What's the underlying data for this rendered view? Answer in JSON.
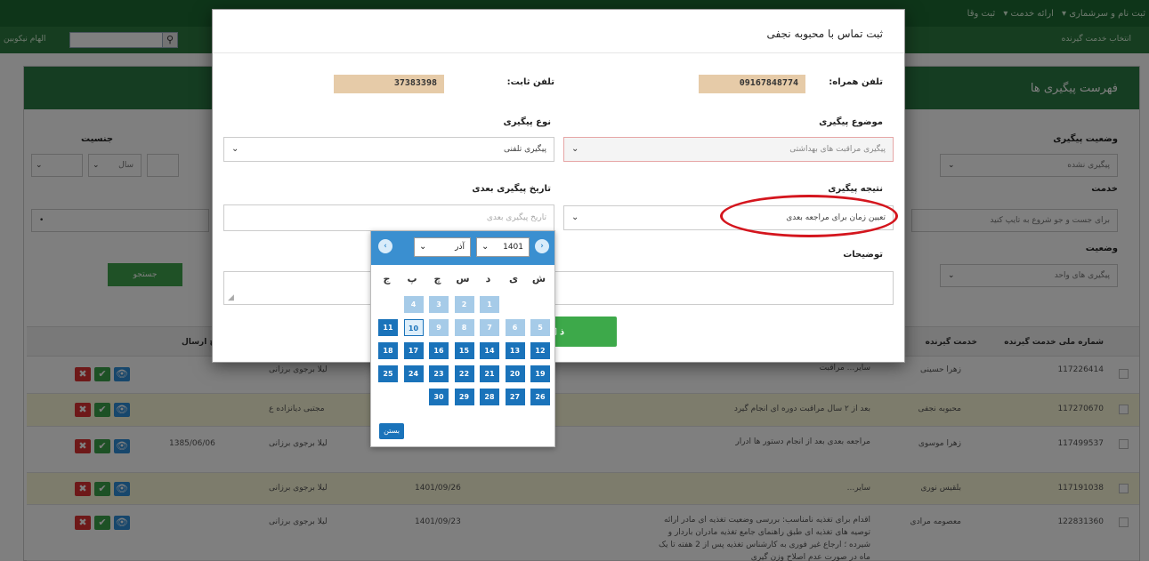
{
  "topbar": {
    "items": [
      "ثبت نام و سرشماری ▾",
      "ارائه خدمت ▾",
      "ثبت وقا"
    ]
  },
  "subbar": {
    "crumb": "انتخاب خدمت گیرنده",
    "user": "الهام نیکوبین",
    "search_placeholder": "جستجو ملی..."
  },
  "panel": {
    "title": "فهرست پیگیری ها",
    "filters": {
      "status_label": "وضعیت پیگیری",
      "status_value": "پیگیری نشده",
      "service_label": "خدمت",
      "service_placeholder": "برای جست و جو شروع به تایپ کنید",
      "state_label": "وضعیت",
      "state_value": "پیگیری های واحد",
      "gender_label": "جنسیت",
      "age_unit": "سال",
      "search_button": "جستجو"
    },
    "table": {
      "headers": [
        "شماره ملی خدمت گیرنده",
        "خدمت گیرنده",
        "تاریخ ارسال"
      ],
      "rows": [
        {
          "id": "117226414",
          "name": "زهرا حسینی",
          "desc": "سایر... مراقبت",
          "staff": "لیلا برجوی برزانی",
          "date": "",
          "send": ""
        },
        {
          "id": "117270670",
          "name": "محبوبه نجفی",
          "desc": "بعد از ۲ سال مراقبت دوره ای انجام گیرد",
          "staff": "مجتبی دیانزاده ع",
          "date": "",
          "send": ""
        },
        {
          "id": "117499537",
          "name": "زهرا موسوی",
          "desc": "مراجعه بعدی بعد از انجام دستور ها ادرار",
          "staff": "لیلا برجوی برزانی",
          "date": "",
          "send": "1385/06/06"
        },
        {
          "id": "117191038",
          "name": "بلقیس نوری",
          "desc": "سایر...",
          "staff": "لیلا برجوی برزانی",
          "date": "1401/09/26",
          "send": ""
        },
        {
          "id": "122831360",
          "name": "معصومه مرادی",
          "desc": "اقدام برای تغذیه نامناسب: بررسی وضعیت تغذیه ای مادر ارائه توصیه های تغذیه ای طبق راهنمای جامع تغذیه مادران باردار و شیرده ؛ ارجاع غیر فوری به کارشناس تغذیه پس از 2 هفته تا یک ماه در صورت عدم اصلاح وزن گیری",
          "staff": "لیلا برجوی برزانی",
          "date": "1401/09/23",
          "send": ""
        }
      ],
      "actions": {
        "delete": "✖",
        "confirm": "✔",
        "view": "👁"
      }
    }
  },
  "modal": {
    "title": "ثبت تماس با محبوبه نجفی",
    "mobile_label": "تلفن همراه:",
    "mobile_value": "09167848774",
    "landline_label": "تلفن ثابت:",
    "landline_value": "37383398",
    "subject_label": "موضوع پیگیری",
    "subject_value": "پیگیری مراقبت های بهداشتی",
    "type_label": "نوع پیگیری",
    "type_value": "پیگیری تلفنی",
    "result_label": "نتیجه پیگیری",
    "result_value": "تعیین زمان برای مراجعه بعدی",
    "next_date_label": "تاریخ پیگیری بعدی",
    "next_date_placeholder": "تاریخ پیگیری بعدی",
    "notes_label": "توضیحات",
    "save_label": "ذ"
  },
  "datepicker": {
    "month": "آذر",
    "year": "1401",
    "weekdays": [
      "ش",
      "ی",
      "د",
      "س",
      "چ",
      "پ",
      "ج"
    ],
    "close_label": "بستن",
    "weeks": [
      [
        "",
        "",
        "1",
        "2",
        "3",
        "4",
        ""
      ],
      [
        "5",
        "6",
        "7",
        "8",
        "9",
        "10",
        "11"
      ],
      [
        "12",
        "13",
        "14",
        "15",
        "16",
        "17",
        "18"
      ],
      [
        "19",
        "20",
        "21",
        "22",
        "23",
        "24",
        "25"
      ],
      [
        "26",
        "27",
        "28",
        "29",
        "30",
        "",
        ""
      ]
    ],
    "today": "10",
    "first_enabled": "11",
    "accent": "#1a73ba"
  }
}
